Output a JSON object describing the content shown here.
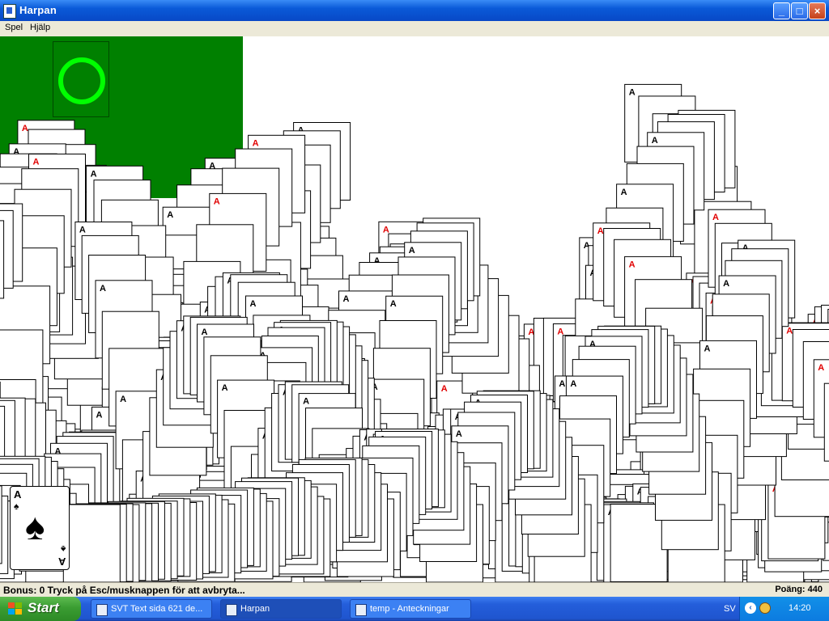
{
  "window": {
    "title": "Harpan",
    "minimize": "_",
    "maximize": "□",
    "close": "×"
  },
  "menu": [
    {
      "label": "Spel"
    },
    {
      "label": "Hjälp"
    }
  ],
  "card": {
    "rank": "A",
    "suit": "♠"
  },
  "status": {
    "message": "Bonus: 0  Tryck på Esc/musknappen för att avbryta...",
    "score": "Poäng: 440"
  },
  "taskbar": {
    "start": "Start",
    "tasks": [
      {
        "label": "SVT Text sida 621 de..."
      },
      {
        "label": "Harpan"
      },
      {
        "label": "temp - Anteckningar"
      }
    ],
    "lang": "SV",
    "clock": "14:20"
  },
  "colors": {
    "felt": "#008000",
    "stock_ring": "#00ff00",
    "title_bar": "#0a5ad8",
    "red_suit": "#e00000"
  },
  "icons": [
    "harpan-app-icon",
    "stock-ring-icon",
    "windows-flag-icon",
    "notepad-icon",
    "tray-arrow-icon",
    "globe-icon"
  ]
}
